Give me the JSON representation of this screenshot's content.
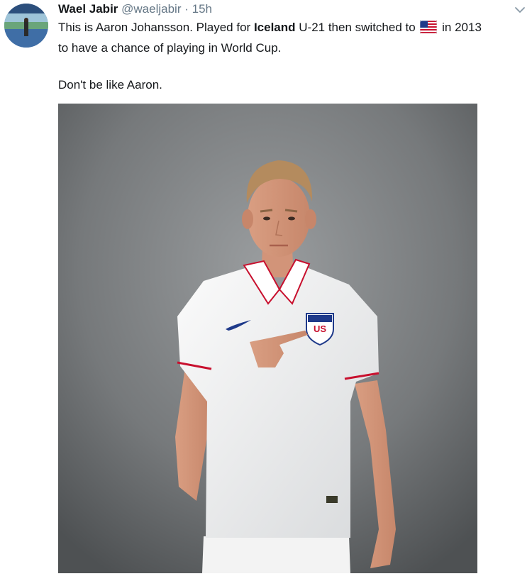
{
  "tweet": {
    "author_name": "Wael Jabir",
    "author_handle": "@waeljabir",
    "separator": "·",
    "time": "15h",
    "text_line1_pre": "This is Aaron Johansson. Played for ",
    "text_bold": "Iceland",
    "text_line1_mid": " U-21 then switched to ",
    "flag_icon": "us-flag-emoji",
    "text_line1_post": " in 2013",
    "text_line2": "to have a chance of playing in World Cup.",
    "text_line3": "Don't be like Aaron.",
    "menu_icon": "chevron-down-icon",
    "photo": {
      "jersey_crest_text": "US"
    }
  },
  "colors": {
    "text_primary": "#14171a",
    "text_secondary": "#657786",
    "chevron": "#8899a6",
    "jersey_trim": "#c8102e",
    "crest_blue": "#1f3a8a"
  }
}
